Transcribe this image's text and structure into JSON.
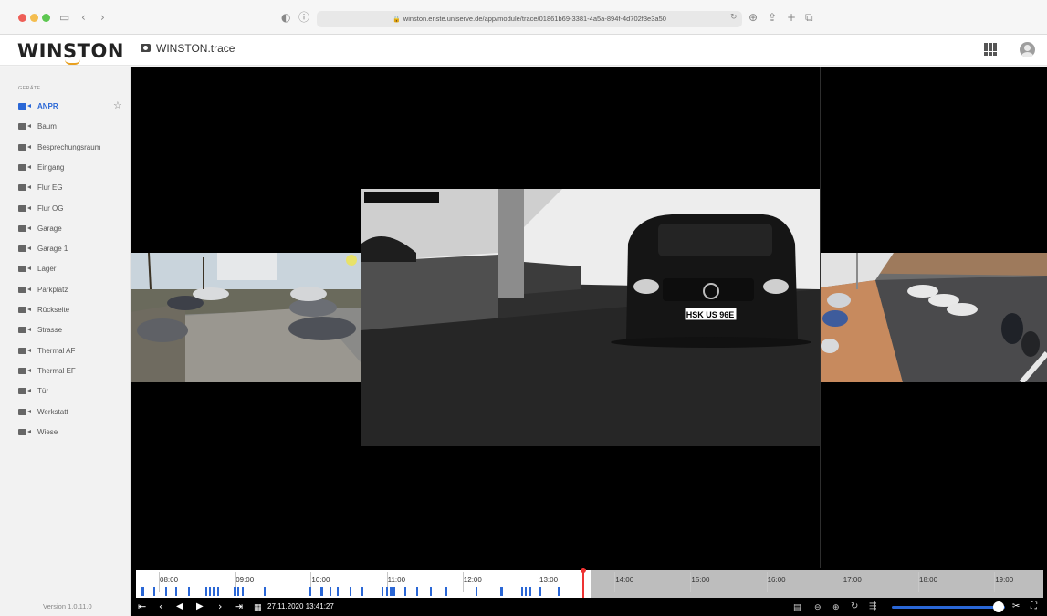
{
  "browser": {
    "url": "winston.enste.uniserve.de/app/module/trace/01861b69-3381-4a5a-894f-4d702f3e3a50"
  },
  "app": {
    "logo": "WINSTON",
    "title": "WINSTON.trace",
    "version": "Version 1.0.11.0"
  },
  "sidebar": {
    "heading": "GERÄTE",
    "items": [
      {
        "label": "ANPR",
        "active": true
      },
      {
        "label": "Baum"
      },
      {
        "label": "Besprechungsraum"
      },
      {
        "label": "Eingang"
      },
      {
        "label": "Flur EG"
      },
      {
        "label": "Flur OG"
      },
      {
        "label": "Garage"
      },
      {
        "label": "Garage 1"
      },
      {
        "label": "Lager"
      },
      {
        "label": "Parkplatz"
      },
      {
        "label": "Rückseite"
      },
      {
        "label": "Strasse"
      },
      {
        "label": "Thermal AF"
      },
      {
        "label": "Thermal EF"
      },
      {
        "label": "Tür"
      },
      {
        "label": "Werkstatt"
      },
      {
        "label": "Wiese"
      }
    ]
  },
  "video": {
    "plate": "HSK US 96E"
  },
  "timeline": {
    "hours": [
      "08:00",
      "09:00",
      "10:00",
      "11:00",
      "12:00",
      "13:00",
      "14:00",
      "15:00",
      "16:00",
      "17:00",
      "18:00",
      "19:00"
    ],
    "now_hour": 13.58
  },
  "controls": {
    "datetime": "27.11.2020 13:41:27",
    "zoom_level": 0.94
  },
  "colors": {
    "accent": "#2a67d6",
    "now_marker": "#e33333"
  }
}
